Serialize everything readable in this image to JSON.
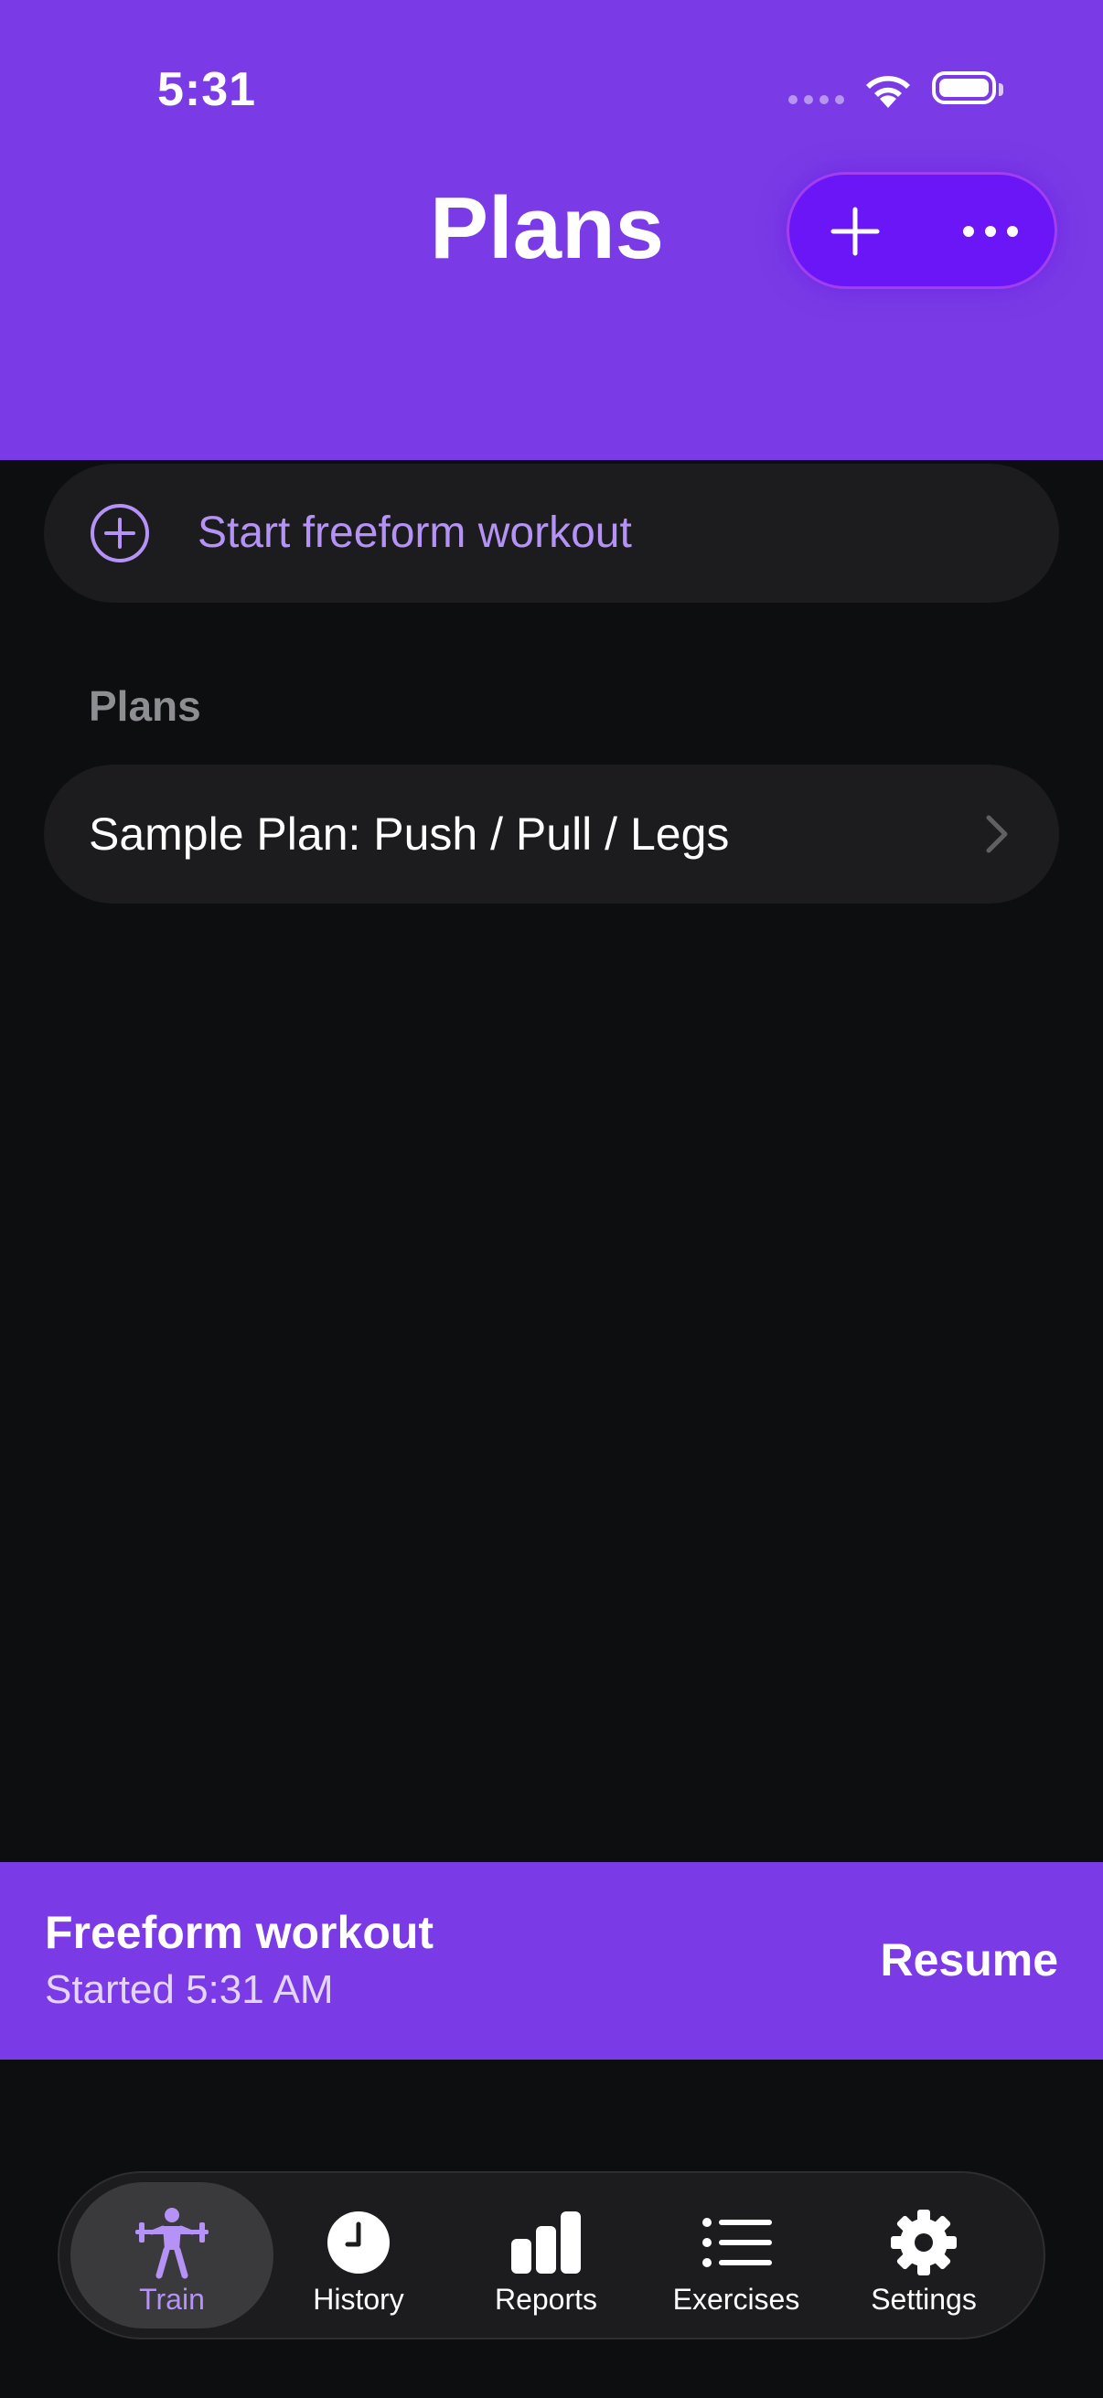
{
  "status_bar": {
    "time": "5:31"
  },
  "header": {
    "title": "Plans"
  },
  "freeform": {
    "label": "Start freeform workout"
  },
  "plans_section": {
    "label": "Plans",
    "items": [
      {
        "label": "Sample Plan: Push / Pull / Legs"
      }
    ]
  },
  "active_workout": {
    "title": "Freeform workout",
    "subtitle": "Started 5:31 AM",
    "action": "Resume"
  },
  "tabs": [
    {
      "label": "Train",
      "icon": "weightlifter-icon",
      "active": true
    },
    {
      "label": "History",
      "icon": "clock-icon",
      "active": false
    },
    {
      "label": "Reports",
      "icon": "bar-chart-icon",
      "active": false
    },
    {
      "label": "Exercises",
      "icon": "list-icon",
      "active": false
    },
    {
      "label": "Settings",
      "icon": "gear-icon",
      "active": false
    }
  ],
  "colors": {
    "accent": "#7a3be6",
    "accent_text": "#b592f5",
    "background": "#0d0e10",
    "card": "#1c1c1e"
  }
}
